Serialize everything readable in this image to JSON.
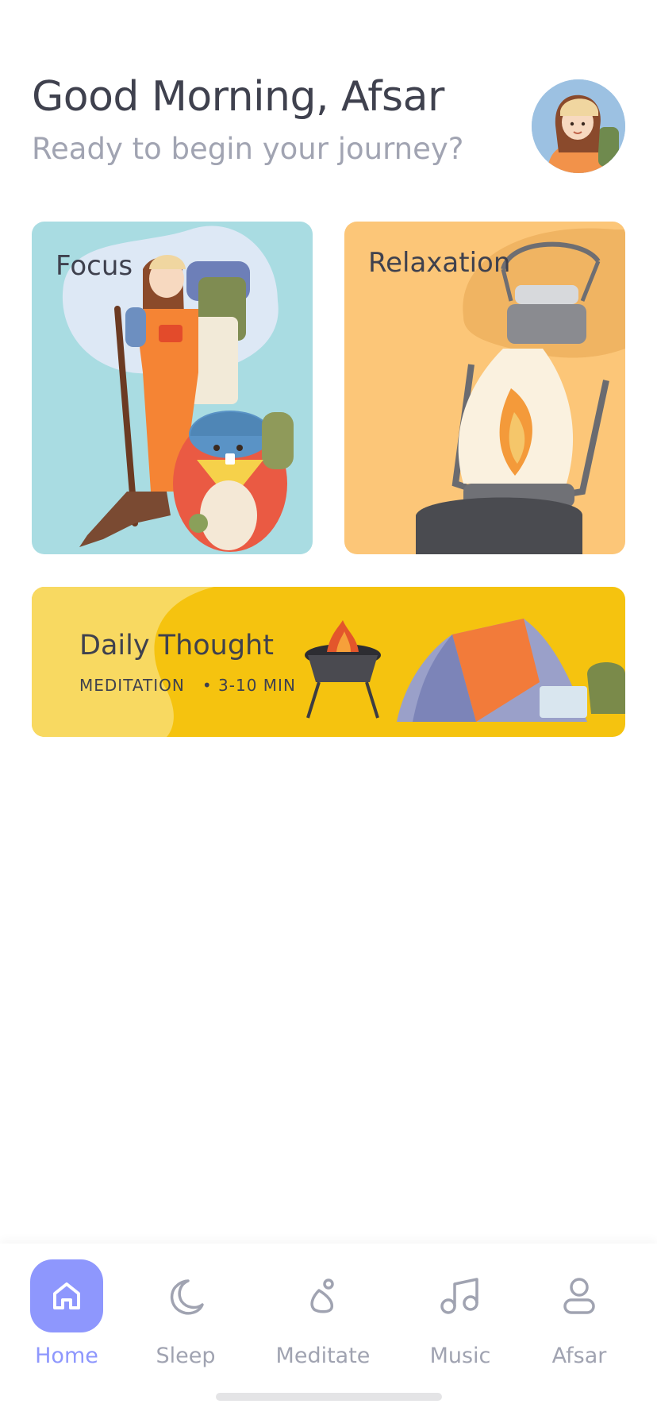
{
  "header": {
    "greeting": "Good Morning, Afsar",
    "subtitle": "Ready to begin your journey?"
  },
  "cards": [
    {
      "label": "Focus",
      "color": "#a9dce2",
      "image": "hiker-with-beaver-illustration"
    },
    {
      "label": "Relaxation",
      "color": "#fcc678",
      "image": "oil-lantern-illustration"
    }
  ],
  "daily": {
    "title": "Daily Thought",
    "category": "MEDITATION",
    "duration": "• 3-10 MIN",
    "color": "#f5c30f",
    "image": "camping-tent-and-grill-illustration"
  },
  "nav": {
    "items": [
      {
        "label": "Home",
        "icon": "home-icon",
        "active": true
      },
      {
        "label": "Sleep",
        "icon": "moon-icon",
        "active": false
      },
      {
        "label": "Meditate",
        "icon": "meditate-icon",
        "active": false
      },
      {
        "label": "Music",
        "icon": "music-note-icon",
        "active": false
      },
      {
        "label": "Afsar",
        "icon": "profile-icon",
        "active": false
      }
    ]
  },
  "colors": {
    "accent": "#8e97fd",
    "text_primary": "#3f414e",
    "text_secondary": "#a1a4b2"
  }
}
